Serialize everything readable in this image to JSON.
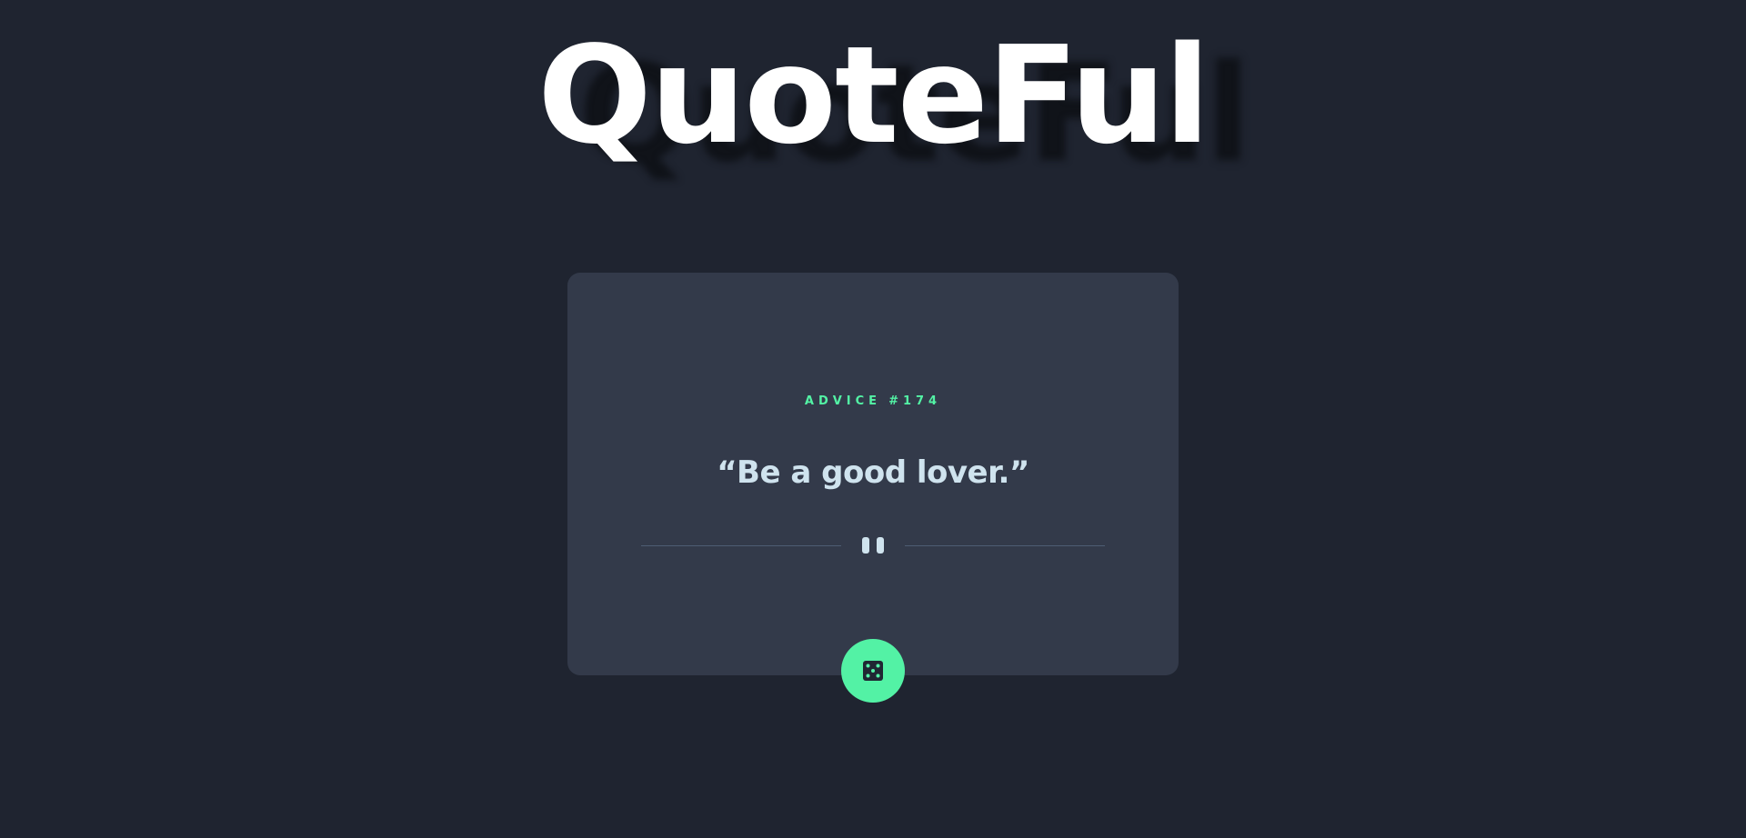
{
  "app": {
    "title": "QuoteFul"
  },
  "card": {
    "advice_label": "ADVICE",
    "advice_number": "#174",
    "quote": "“Be a good lover.”"
  },
  "icons": {
    "divider": "pause-icon",
    "button": "dice-icon"
  },
  "colors": {
    "background": "#1f2430",
    "card": "#333a4a",
    "accent": "#53f2a5",
    "quote_text": "#cfe3ee",
    "title_text": "#ffffff"
  }
}
